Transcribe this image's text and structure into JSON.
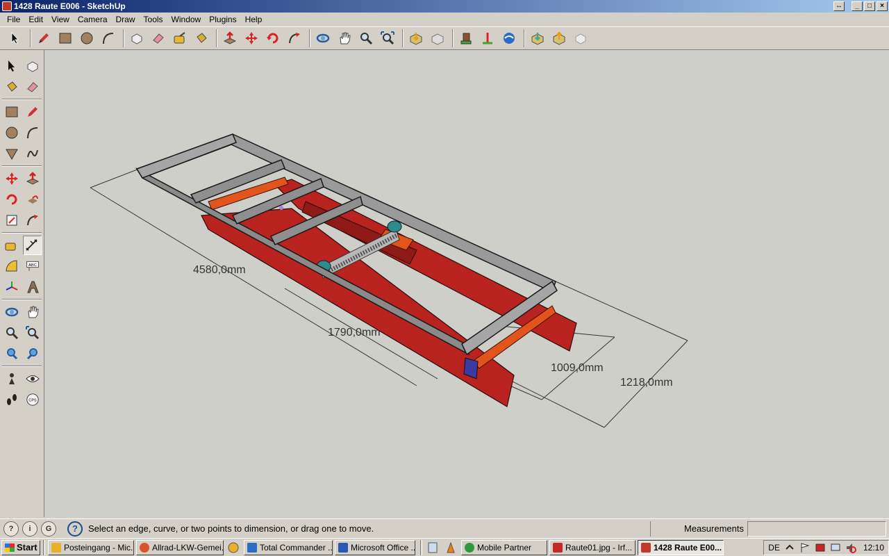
{
  "window": {
    "title": "1428 Raute E006 - SketchUp",
    "restore_glyph": "↔",
    "min_glyph": "_",
    "max_glyph": "□",
    "close_glyph": "×"
  },
  "menubar": {
    "items": [
      "File",
      "Edit",
      "View",
      "Camera",
      "Draw",
      "Tools",
      "Window",
      "Plugins",
      "Help"
    ]
  },
  "toolbar": {
    "icons": [
      "select-icon",
      "pencil-icon",
      "rectangle-icon",
      "circle-icon",
      "arc-icon",
      "make-component-icon",
      "eraser-icon",
      "tape-measure-icon",
      "paint-bucket-icon",
      "push-pull-icon",
      "move-icon",
      "rotate-icon",
      "follow-me-icon",
      "orbit-icon",
      "pan-icon",
      "zoom-icon",
      "zoom-extents-icon",
      "get-models-icon",
      "share-model-icon",
      "components-icon",
      "add-location-icon",
      "google-earth-icon",
      "get-photo-textures-icon",
      "share-component-icon",
      "preview-icon"
    ]
  },
  "lefttools": {
    "text_tool_label": "ABC",
    "bottom_label": "CPS"
  },
  "viewport": {
    "background": "#cfcfc9",
    "dimensions": {
      "total_length": "4580,0mm",
      "cross_span": "1790,0mm",
      "inner_width": "1009,0mm",
      "outer_width": "1218,0mm"
    },
    "colors": {
      "frame_gray": "#8f8f8f",
      "rail_red": "#b8231f",
      "bracket_orange": "#e2541c",
      "spindle_teal": "#2e8b8b"
    }
  },
  "statusbar": {
    "icons": [
      "geo-location-icon",
      "credits-icon",
      "user-icon"
    ],
    "icon_glyphs": [
      "?",
      "i",
      "G"
    ],
    "help_glyph": "?",
    "message": "Select an edge, curve, or two points to dimension, or drag one to move.",
    "measurements_label": "Measurements",
    "measurements_value": ""
  },
  "taskbar": {
    "start_label": "Start",
    "tasks": [
      {
        "label": "Posteingang - Mic...",
        "color": "#e9b12a"
      },
      {
        "label": "Allrad-LKW-Gemei...",
        "color": "#d9542a"
      },
      {
        "label": "Total Commander ...",
        "color": "#2b6bc4"
      },
      {
        "label": "Microsoft Office ...",
        "color": "#2a56b4"
      },
      {
        "label": "Mobile Partner",
        "color": "#2a9a3a"
      },
      {
        "label": "Raute01.jpg - Irf...",
        "color": "#c22a2a"
      },
      {
        "label": "1428 Raute E00...",
        "color": "#c0392b"
      }
    ],
    "language": "DE",
    "clock": "12:10"
  }
}
